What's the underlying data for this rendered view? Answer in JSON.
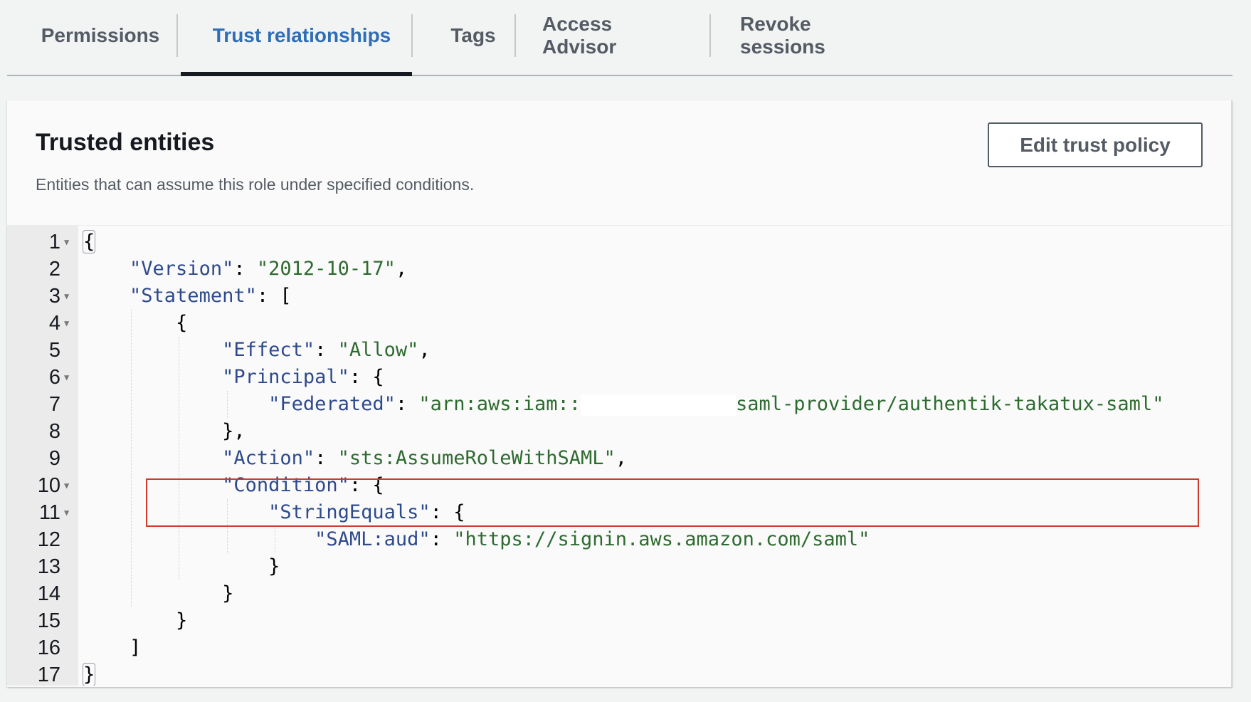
{
  "tabs": [
    {
      "label": "Permissions",
      "active": false
    },
    {
      "label": "Trust relationships",
      "active": true
    },
    {
      "label": "Tags",
      "active": false
    },
    {
      "label": "Access Advisor",
      "active": false
    },
    {
      "label": "Revoke sessions",
      "active": false
    }
  ],
  "panel": {
    "title": "Trusted entities",
    "description": "Entities that can assume this role under specified conditions.",
    "edit_button": "Edit trust policy"
  },
  "colors": {
    "active_tab": "#2f6eb5",
    "json_key": "#2e4a8c",
    "json_string": "#2e6b30",
    "highlight_box": "#d13a2c"
  },
  "editor": {
    "lines": [
      {
        "n": "1",
        "fold": true
      },
      {
        "n": "2",
        "fold": false
      },
      {
        "n": "3",
        "fold": true
      },
      {
        "n": "4",
        "fold": true
      },
      {
        "n": "5",
        "fold": false
      },
      {
        "n": "6",
        "fold": true
      },
      {
        "n": "7",
        "fold": false
      },
      {
        "n": "8",
        "fold": false
      },
      {
        "n": "9",
        "fold": false
      },
      {
        "n": "10",
        "fold": true
      },
      {
        "n": "11",
        "fold": true
      },
      {
        "n": "12",
        "fold": false
      },
      {
        "n": "13",
        "fold": false
      },
      {
        "n": "14",
        "fold": false
      },
      {
        "n": "15",
        "fold": false
      },
      {
        "n": "16",
        "fold": false
      },
      {
        "n": "17",
        "fold": false
      }
    ],
    "tokens": {
      "open_brace": "{",
      "close_brace": "}",
      "open_bracket": "[",
      "close_bracket": "]",
      "version_key": "\"Version\"",
      "version_val": "\"2012-10-17\"",
      "statement_key": "\"Statement\"",
      "effect_key": "\"Effect\"",
      "effect_val": "\"Allow\"",
      "principal_key": "\"Principal\"",
      "federated_key": "\"Federated\"",
      "federated_val_prefix": "\"arn:aws:iam::",
      "federated_val_suffix": "saml-provider/authentik-takatux-saml\"",
      "action_key": "\"Action\"",
      "action_val": "\"sts:AssumeRoleWithSAML\"",
      "condition_key": "\"Condition\"",
      "stringequals_key": "\"StringEquals\"",
      "samlaud_key": "\"SAML:aud\"",
      "samlaud_val": "\"https://signin.aws.amazon.com/saml\""
    }
  }
}
